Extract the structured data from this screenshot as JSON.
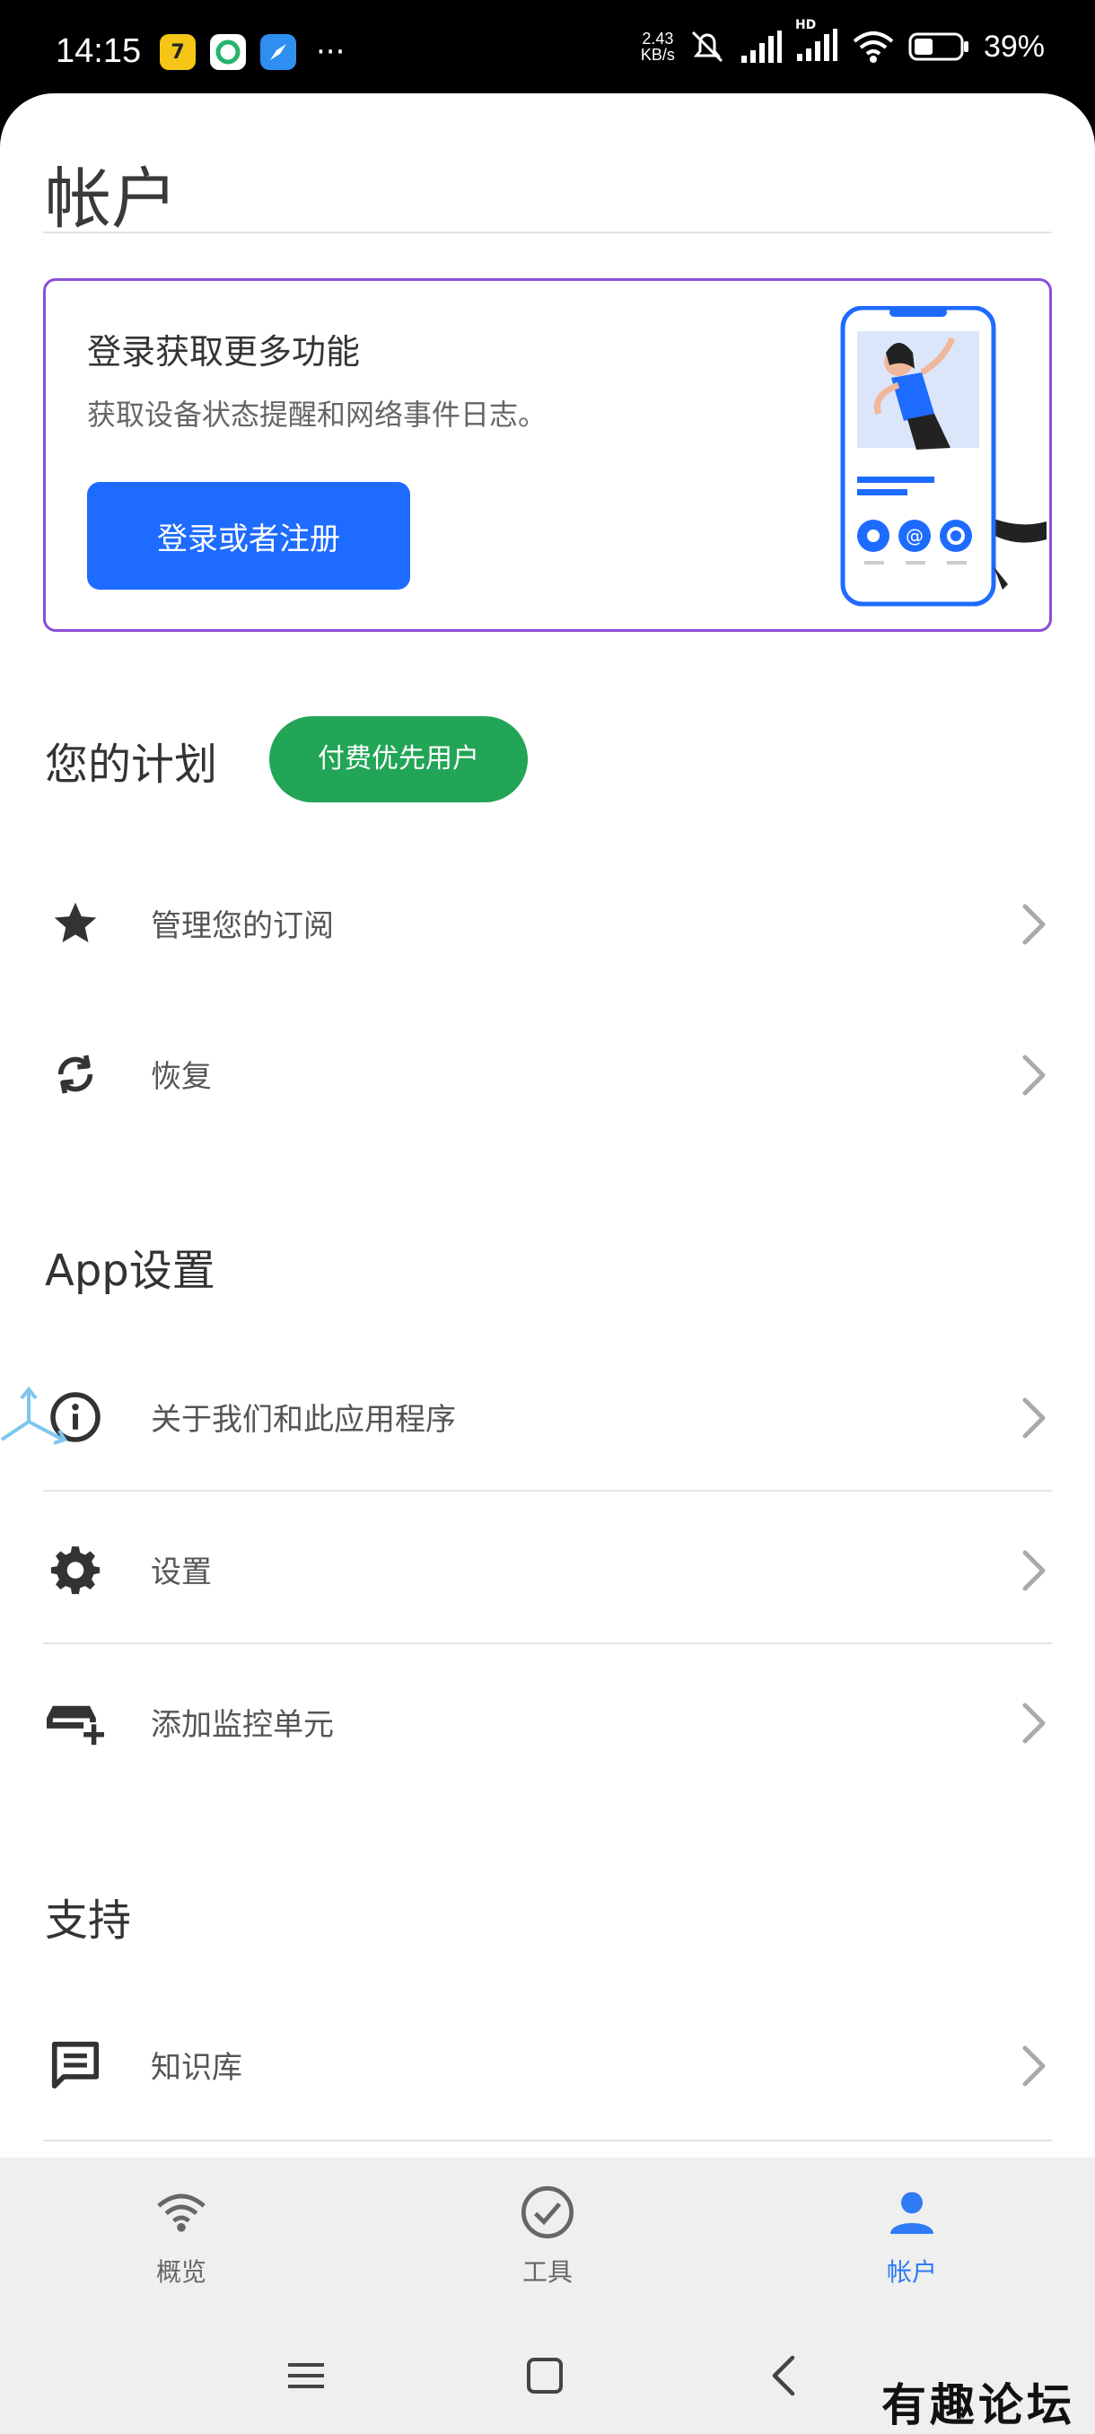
{
  "status_bar": {
    "time": "14:15",
    "net_speed_value": "2.43",
    "net_speed_unit": "KB/s",
    "signal_badge": "HD",
    "battery": "39%"
  },
  "page": {
    "title": "帐户"
  },
  "login_card": {
    "heading": "登录获取更多功能",
    "subtitle": "获取设备状态提醒和网络事件日志。",
    "button": "登录或者注册"
  },
  "plan": {
    "header": "您的计划",
    "badge": "付费优先用户",
    "items": [
      {
        "label": "管理您的订阅",
        "icon": "star-icon"
      },
      {
        "label": "恢复",
        "icon": "refresh-icon"
      }
    ]
  },
  "app_settings": {
    "header": "App设置",
    "items": [
      {
        "label": "关于我们和此应用程序",
        "icon": "info-icon"
      },
      {
        "label": "设置",
        "icon": "gear-icon"
      },
      {
        "label": "添加监控单元",
        "icon": "add-device-icon"
      }
    ]
  },
  "support": {
    "header": "支持",
    "items": [
      {
        "label": "知识库",
        "icon": "message-icon"
      }
    ]
  },
  "bottom_nav": {
    "items": [
      {
        "label": "概览",
        "icon": "wifi-icon",
        "active": false
      },
      {
        "label": "工具",
        "icon": "check-circle-icon",
        "active": false
      },
      {
        "label": "帐户",
        "icon": "person-icon",
        "active": true
      }
    ]
  },
  "watermark": "有趣论坛",
  "colors": {
    "primary": "#1e6bff",
    "badge_green": "#22a556",
    "card_border": "#8a4fd6",
    "nav_active": "#2f7bf5"
  }
}
